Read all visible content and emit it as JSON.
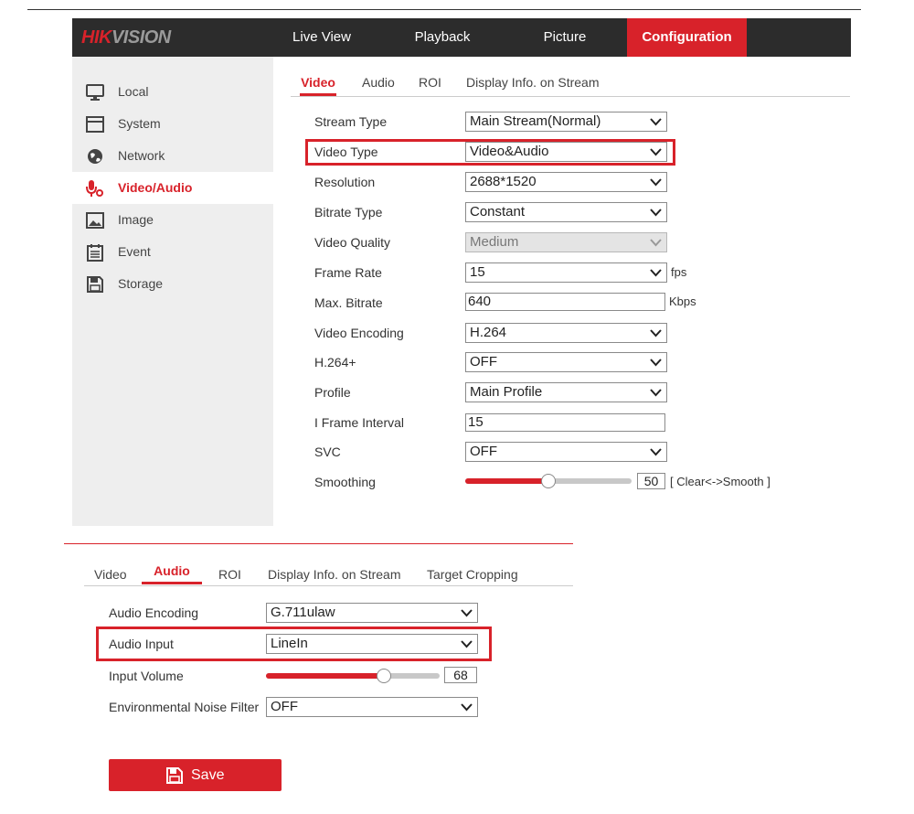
{
  "header": {
    "logo_red": "HIK",
    "logo_rest": "VISION",
    "nav": [
      "Live View",
      "Playback",
      "Picture",
      "Configuration"
    ],
    "active_nav": "Configuration"
  },
  "sidebar": {
    "items": [
      {
        "label": "Local",
        "icon": "monitor-icon"
      },
      {
        "label": "System",
        "icon": "window-icon"
      },
      {
        "label": "Network",
        "icon": "globe-icon"
      },
      {
        "label": "Video/Audio",
        "icon": "microphone-icon",
        "active": true
      },
      {
        "label": "Image",
        "icon": "image-icon"
      },
      {
        "label": "Event",
        "icon": "calendar-icon"
      },
      {
        "label": "Storage",
        "icon": "save-disk-icon"
      }
    ]
  },
  "video": {
    "tabs": [
      "Video",
      "Audio",
      "ROI",
      "Display Info. on Stream"
    ],
    "active_tab": "Video",
    "fields": [
      {
        "label": "Stream Type",
        "type": "select",
        "value": "Main Stream(Normal)"
      },
      {
        "label": "Video Type",
        "type": "select",
        "value": "Video&Audio",
        "highlighted": true
      },
      {
        "label": "Resolution",
        "type": "select",
        "value": "2688*1520"
      },
      {
        "label": "Bitrate Type",
        "type": "select",
        "value": "Constant"
      },
      {
        "label": "Video Quality",
        "type": "select",
        "value": "Medium",
        "disabled": true
      },
      {
        "label": "Frame Rate",
        "type": "select",
        "value": "15",
        "unit": "fps"
      },
      {
        "label": "Max. Bitrate",
        "type": "text",
        "value": "640",
        "unit": "Kbps"
      },
      {
        "label": "Video Encoding",
        "type": "select",
        "value": "H.264"
      },
      {
        "label": "H.264+",
        "type": "select",
        "value": "OFF"
      },
      {
        "label": "Profile",
        "type": "select",
        "value": "Main Profile"
      },
      {
        "label": "I Frame Interval",
        "type": "text",
        "value": "15"
      },
      {
        "label": "SVC",
        "type": "select",
        "value": "OFF"
      },
      {
        "label": "Smoothing",
        "type": "slider",
        "value": 50,
        "value_text": "50",
        "unit": "[ Clear<->Smooth ]"
      }
    ]
  },
  "audio": {
    "tabs": [
      "Video",
      "Audio",
      "ROI",
      "Display Info. on Stream",
      "Target Cropping"
    ],
    "active_tab": "Audio",
    "fields": [
      {
        "label": "Audio Encoding",
        "type": "select",
        "value": "G.711ulaw"
      },
      {
        "label": "Audio Input",
        "type": "select",
        "value": "LineIn",
        "highlighted": true
      },
      {
        "label": "Input Volume",
        "type": "slider",
        "value": 68,
        "value_text": "68"
      },
      {
        "label": "Environmental Noise Filter",
        "type": "select",
        "value": "OFF"
      }
    ],
    "save_label": "Save"
  },
  "colors": {
    "accent": "#d8222a",
    "header_bg": "#2c2c2c",
    "sidebar_bg": "#eeeeee"
  }
}
